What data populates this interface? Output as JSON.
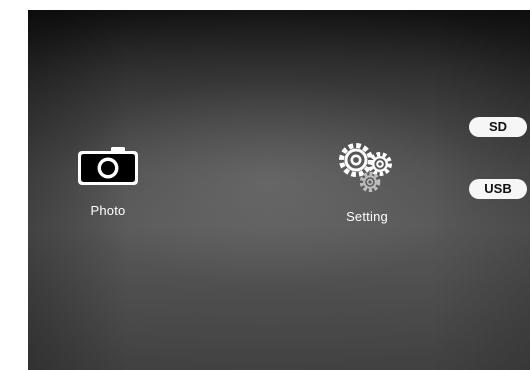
{
  "menu": {
    "items": [
      {
        "label": "Photo",
        "icon": "camera-icon"
      },
      {
        "label": "Setting",
        "icon": "gears-icon"
      }
    ]
  },
  "storage": {
    "options": [
      {
        "label": "SD"
      },
      {
        "label": "USB"
      }
    ]
  },
  "colors": {
    "background_top": "#101010",
    "background_mid": "#585858",
    "text": "#ffffff",
    "pill_background": "#f6f6f6",
    "pill_text": "#111111"
  }
}
